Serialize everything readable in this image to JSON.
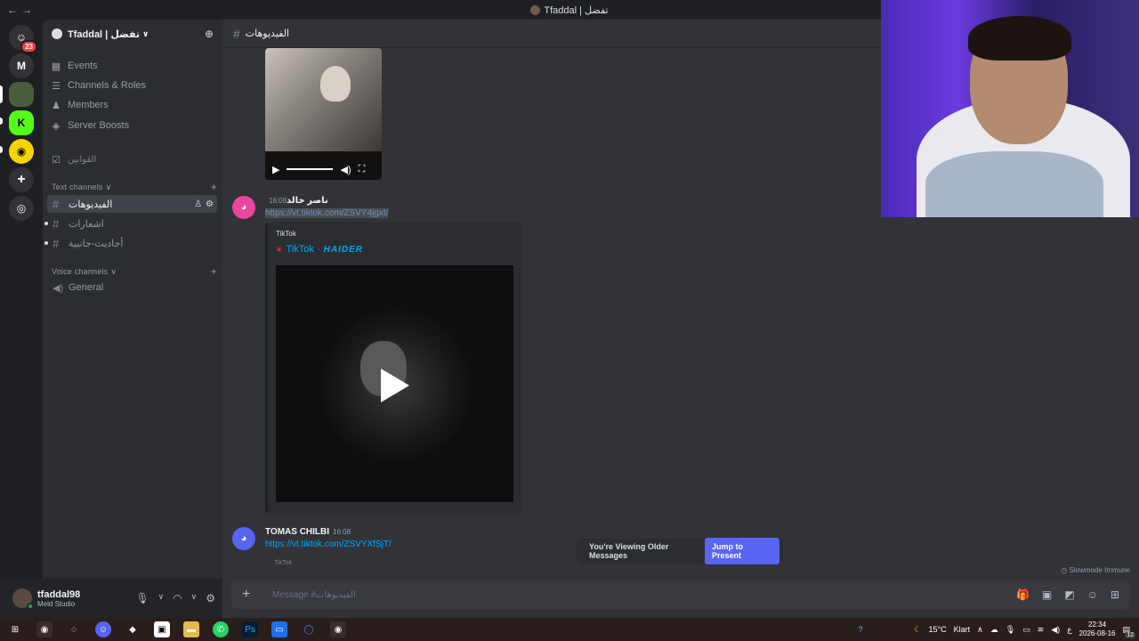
{
  "titlebar": {
    "title": "Tfaddal | تفضل"
  },
  "rail": {
    "badge": "23",
    "m_label": "M"
  },
  "server": {
    "name": "Tfaddal | تفضل"
  },
  "menu": [
    {
      "label": "Events",
      "icon": "calendar-icon"
    },
    {
      "label": "Channels & Roles",
      "icon": "list-icon"
    },
    {
      "label": "Members",
      "icon": "members-icon"
    },
    {
      "label": "Server Boosts",
      "icon": "boost-icon"
    }
  ],
  "rules_channel": "القوانين",
  "categories": {
    "text": "Text channels",
    "voice": "Voice channels"
  },
  "text_channels": [
    "الفيديوهات",
    "اشعارات",
    "أحاديث-جانبية"
  ],
  "voice_channels": [
    "General"
  ],
  "user": {
    "name": "tfaddal98",
    "status": "Meld Studio"
  },
  "channel_header": "الفيديوهات",
  "messages": {
    "m1": {
      "author": "ناصر خالد",
      "time": "16:08",
      "link": "https://vt.tiktok.com/ZSVY4jgxt/"
    },
    "embed": {
      "provider": "TikTok",
      "author_prefix": "TikTok ·",
      "author_name": "HAIDER"
    },
    "m2": {
      "author": "TOMAS CHILBI",
      "time": "16:08",
      "link": "https://vt.tiktok.com/ZSVYXfSjT/",
      "preview": "TikTok"
    }
  },
  "older": {
    "text": "You're Viewing Older Messages",
    "jump": "Jump to Present"
  },
  "slowmode": "Slowmode Immune",
  "composer": {
    "placeholder": "Message #الفيديوهات"
  },
  "taskbar": {
    "weather": "15°C",
    "weather_desc": "Klart",
    "time": "22:34",
    "date": "2026-08-16",
    "lang": "ع",
    "notif": "12"
  },
  "colors": {
    "accent": "#5865f2",
    "link": "#00a8fc",
    "bg_main": "#313338",
    "bg_sidebar": "#2b2d31"
  }
}
